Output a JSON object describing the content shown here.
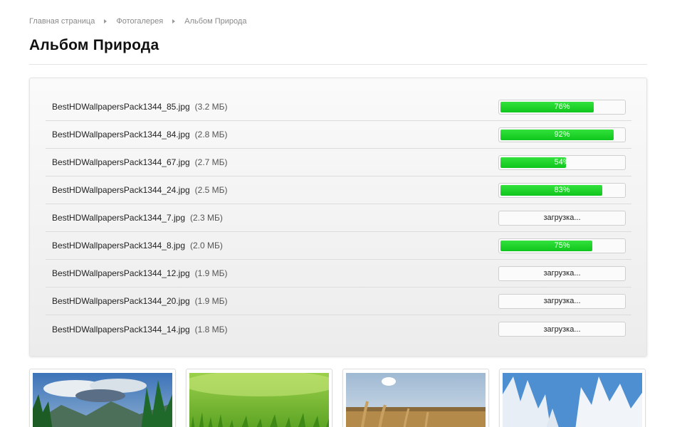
{
  "breadcrumb": {
    "home": "Главная страница",
    "gallery": "Фотогалерея",
    "current": "Альбом Природа"
  },
  "page": {
    "title": "Альбом Природа"
  },
  "colors": {
    "progress_green": "#18c924",
    "border": "#cfcfcf"
  },
  "uploads": [
    {
      "name": "BestHDWallpapersPack1344_85.jpg",
      "size": "(3.2 МБ)",
      "progress": 76,
      "label": "76%"
    },
    {
      "name": "BestHDWallpapersPack1344_84.jpg",
      "size": "(2.8 МБ)",
      "progress": 92,
      "label": "92%"
    },
    {
      "name": "BestHDWallpapersPack1344_67.jpg",
      "size": "(2.7 МБ)",
      "progress": 54,
      "label": "54%"
    },
    {
      "name": "BestHDWallpapersPack1344_24.jpg",
      "size": "(2.5 МБ)",
      "progress": 83,
      "label": "83%"
    },
    {
      "name": "BestHDWallpapersPack1344_7.jpg",
      "size": "(2.3 МБ)",
      "progress": null,
      "label": "загрузка..."
    },
    {
      "name": "BestHDWallpapersPack1344_8.jpg",
      "size": "(2.0 МБ)",
      "progress": 75,
      "label": "75%"
    },
    {
      "name": "BestHDWallpapersPack1344_12.jpg",
      "size": "(1.9 МБ)",
      "progress": null,
      "label": "загрузка..."
    },
    {
      "name": "BestHDWallpapersPack1344_20.jpg",
      "size": "(1.9 МБ)",
      "progress": null,
      "label": "загрузка..."
    },
    {
      "name": "BestHDWallpapersPack1344_14.jpg",
      "size": "(1.8 МБ)",
      "progress": null,
      "label": "загрузка..."
    }
  ],
  "thumbnails": [
    {
      "subject": "mountain-forest-photo"
    },
    {
      "subject": "grass-meadow-photo"
    },
    {
      "subject": "wheat-field-photo"
    },
    {
      "subject": "snowy-trees-photo"
    }
  ]
}
